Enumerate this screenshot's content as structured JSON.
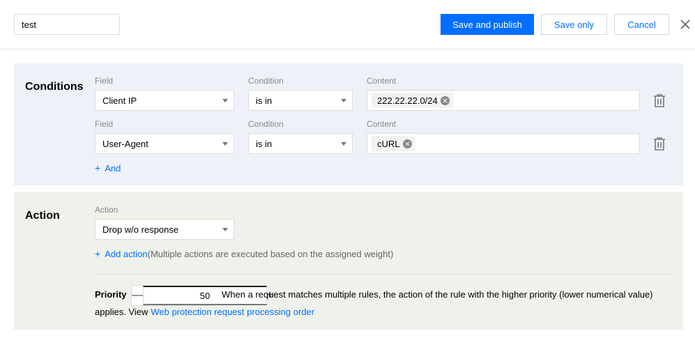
{
  "header": {
    "name_value": "test",
    "save_publish_label": "Save and publish",
    "save_only_label": "Save only",
    "cancel_label": "Cancel",
    "close_icon": "close-icon"
  },
  "conditions": {
    "title": "Conditions",
    "rows": [
      {
        "field_label": "Field",
        "field_value": "Client IP",
        "condition_label": "Condition",
        "condition_value": "is in",
        "content_label": "Content",
        "tags": [
          "222.22.22.0/24"
        ]
      },
      {
        "field_label": "Field",
        "field_value": "User-Agent",
        "condition_label": "Condition",
        "condition_value": "is in",
        "content_label": "Content",
        "tags": [
          "cURL"
        ]
      }
    ],
    "add_label": "And"
  },
  "action": {
    "title": "Action",
    "action_label": "Action",
    "action_value": "Drop w/o response",
    "add_action_label": "Add action",
    "add_action_hint": "(Multiple actions are executed based on the assigned weight)",
    "priority_label": "Priority",
    "priority_value": "50",
    "priority_desc": "When a request matches multiple rules, the action of the rule with the higher priority (lower numerical value)",
    "priority_desc2": "applies. View",
    "priority_link": "Web protection request processing order"
  },
  "colors": {
    "accent": "#006eff",
    "conditions_bg": "#eef1f7",
    "action_bg": "#eff2ea"
  }
}
